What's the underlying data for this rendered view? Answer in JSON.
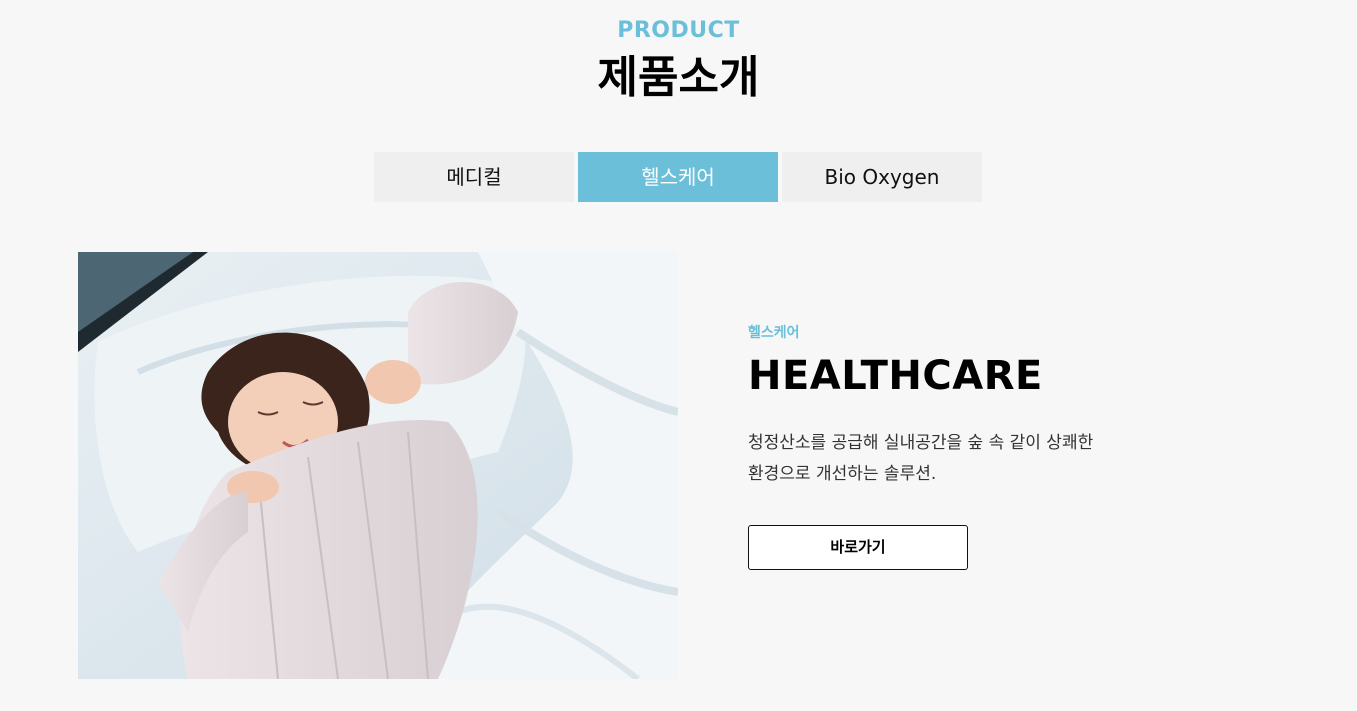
{
  "theme": {
    "accent": "#6cbfd9",
    "background": "#f7f7f7",
    "tab_inactive": "#efefef"
  },
  "section": {
    "eyebrow": "PRODUCT",
    "title": "제품소개"
  },
  "tabs": [
    {
      "label": "메디컬",
      "active": false
    },
    {
      "label": "헬스케어",
      "active": true
    },
    {
      "label": "Bio Oxygen",
      "active": false
    }
  ],
  "hero": {
    "image_subject": "woman-waking-up-in-bed-photo"
  },
  "detail": {
    "eyebrow": "헬스케어",
    "title": "HEALTHCARE",
    "description_line1": "청정산소를 공급해 실내공간을 숲 속 같이 상쾌한",
    "description_line2": "환경으로 개선하는 솔루션.",
    "button_label": "바로가기"
  }
}
